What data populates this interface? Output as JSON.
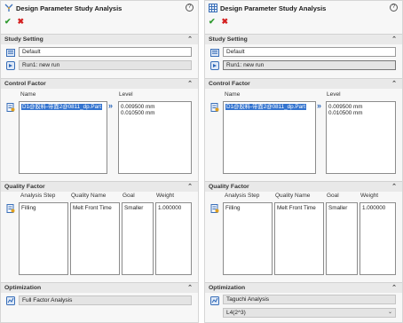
{
  "panels": [
    {
      "title": "Design Parameter Study Analysis",
      "help_label": "?",
      "study_setting": {
        "header": "Study Setting",
        "default_value": "Default",
        "run_value": "Run1: new run"
      },
      "control_factor": {
        "header": "Control Factor",
        "name_label": "Name",
        "level_label": "Level",
        "name_item": "D1@胶料-带面2@0811_dp.Part",
        "levels": [
          "0.009500 mm",
          "0.010500 mm"
        ]
      },
      "quality_factor": {
        "header": "Quality Factor",
        "columns": [
          "Analysis Step",
          "Quality Name",
          "Goal",
          "Weight"
        ],
        "values": [
          "Filling",
          "Melt Front Time",
          "Smaller",
          "1.000000"
        ]
      },
      "optimization": {
        "header": "Optimization",
        "method": "Full Factor Analysis"
      }
    },
    {
      "title": "Design Parameter Study Analysis",
      "help_label": "?",
      "study_setting": {
        "header": "Study Setting",
        "default_value": "Default",
        "run_value": "Run1: new run"
      },
      "control_factor": {
        "header": "Control Factor",
        "name_label": "Name",
        "level_label": "Level",
        "name_item": "D1@胶料-带面2@0811_dp.Part",
        "levels": [
          "0.009500 mm",
          "0.010500 mm"
        ]
      },
      "quality_factor": {
        "header": "Quality Factor",
        "columns": [
          "Analysis Step",
          "Quality Name",
          "Goal",
          "Weight"
        ],
        "values": [
          "Filling",
          "Melt Front Time",
          "Smaller",
          "1.000000"
        ]
      },
      "optimization": {
        "header": "Optimization",
        "method": "Taguchi Analysis",
        "array": "L4(2^3)"
      }
    }
  ],
  "icons": {
    "title_left": "study-analysis-icon",
    "title_right": "table-study-icon",
    "ok": "check-icon",
    "cancel": "close-icon",
    "collapse": "chevron-up-icon"
  },
  "colors": {
    "selection": "#3373cf",
    "ok": "#2f9a2f",
    "cancel": "#d42020",
    "accent": "#2b66b8"
  }
}
